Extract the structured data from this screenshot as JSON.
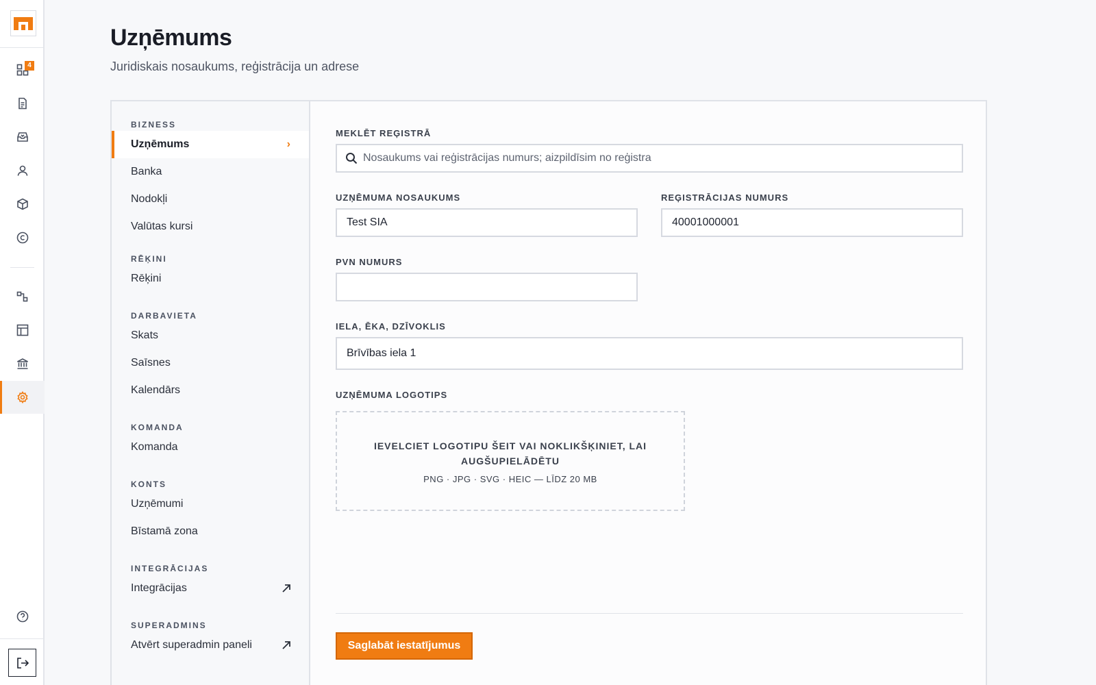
{
  "rail": {
    "notification_count": "4"
  },
  "header": {
    "title": "Uzņēmums",
    "subtitle": "Juridiskais nosaukums, reģistrācija un adrese"
  },
  "subnav": {
    "sections": [
      {
        "heading": "BIZNESS",
        "items": [
          "Uzņēmums",
          "Banka",
          "Nodokļi",
          "Valūtas kursi"
        ]
      },
      {
        "heading": "RĒĶINI",
        "items": [
          "Rēķini"
        ]
      },
      {
        "heading": "DARBAVIETA",
        "items": [
          "Skats",
          "Saīsnes",
          "Kalendārs"
        ]
      },
      {
        "heading": "KOMANDA",
        "items": [
          "Komanda"
        ]
      },
      {
        "heading": "KONTS",
        "items": [
          "Uzņēmumi",
          "Bīstamā zona"
        ]
      },
      {
        "heading": "INTEGRĀCIJAS",
        "items": [
          "Integrācijas"
        ]
      },
      {
        "heading": "SUPERADMINS",
        "items": [
          "Atvērt superadmin paneli"
        ]
      }
    ],
    "active_item": "Uzņēmums"
  },
  "form": {
    "search": {
      "label": "MEKLĒT REĢISTRĀ",
      "placeholder": "Nosaukums vai reģistrācijas numurs; aizpildīsim no reģistra"
    },
    "company_name": {
      "label": "UZŅĒMUMA NOSAUKUMS",
      "value": "Test SIA"
    },
    "reg_number": {
      "label": "REĢISTRĀCIJAS NUMURS",
      "value": "40001000001"
    },
    "vat_number": {
      "label": "PVN NUMURS",
      "value": ""
    },
    "street": {
      "label": "IELA, ĒKA, DZĪVOKLIS",
      "value": "Brīvības iela 1"
    },
    "logo": {
      "label": "UZŅĒMUMA LOGOTIPS",
      "dropzone_text": "IEVELCIET LOGOTIPU ŠEIT VAI NOKLIKŠĶINIET, LAI AUGŠUPIELĀDĒTU",
      "formats_text": "PNG · JPG · SVG · HEIC — LĪDZ 20 MB"
    },
    "save_label": "Saglabāt iestatījumus"
  },
  "colors": {
    "accent": "#f07c12",
    "background": "#f7f8fa",
    "text": "#1f2430"
  },
  "icons": {
    "rail": [
      "dashboard-icon",
      "document-icon",
      "inbox-icon",
      "user-icon",
      "box-icon",
      "copyright-icon",
      "flow-icon",
      "layout-icon",
      "bank-icon",
      "gear-icon",
      "help-icon",
      "logout-icon"
    ]
  }
}
